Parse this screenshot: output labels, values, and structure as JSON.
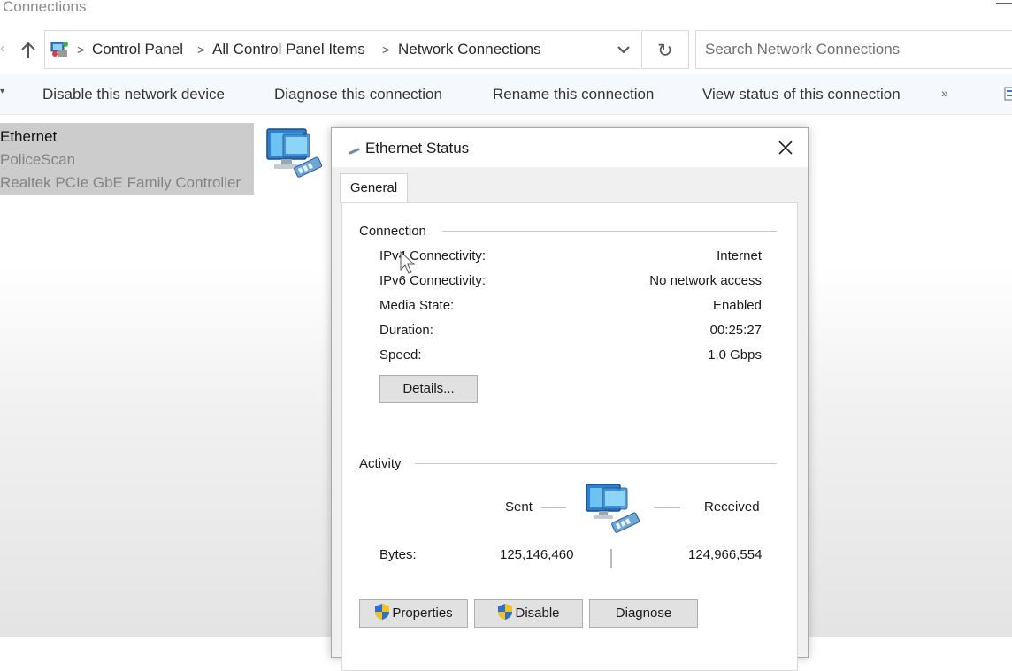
{
  "window": {
    "title": "Connections",
    "minimize_glyph": "—"
  },
  "address_bar": {
    "icon": "control-panel-icon",
    "breadcrumbs": [
      "Control Panel",
      "All Control Panel Items",
      "Network Connections"
    ],
    "separator": ">",
    "refresh_glyph": "↻",
    "search_placeholder": "Search Network Connections"
  },
  "command_bar": {
    "items": [
      "Disable this network device",
      "Diagnose this connection",
      "Rename this connection",
      "View status of this connection"
    ],
    "more_glyph": "»"
  },
  "connection": {
    "name": "Ethernet",
    "network": "PoliceScan",
    "adapter": "Realtek PCIe GbE Family Controller",
    "icon": "network-adapter-icon"
  },
  "dialog": {
    "title": "Ethernet Status",
    "title_icon": "ethernet-cable-icon",
    "close_glyph": "✕",
    "tab": "General",
    "connection_group": {
      "label": "Connection",
      "rows": [
        {
          "label": "IPv4 Connectivity:",
          "value": "Internet"
        },
        {
          "label": "IPv6 Connectivity:",
          "value": "No network access"
        },
        {
          "label": "Media State:",
          "value": "Enabled"
        },
        {
          "label": "Duration:",
          "value": "00:25:27"
        },
        {
          "label": "Speed:",
          "value": "1.0 Gbps"
        }
      ],
      "details_button": "Details..."
    },
    "activity_group": {
      "label": "Activity",
      "sent_label": "Sent",
      "received_label": "Received",
      "bytes_label": "Bytes:",
      "bytes_sent": "125,146,460",
      "bytes_received": "124,966,554",
      "icon": "network-activity-icon"
    },
    "buttons": {
      "properties": "Properties",
      "disable": "Disable",
      "diagnose": "Diagnose"
    }
  },
  "colors": {
    "selection": "#cccccc",
    "command_bar_bg": "#f5f8fc",
    "dialog_bg": "#f0f0f0",
    "button_bg": "#e1e1e1"
  }
}
